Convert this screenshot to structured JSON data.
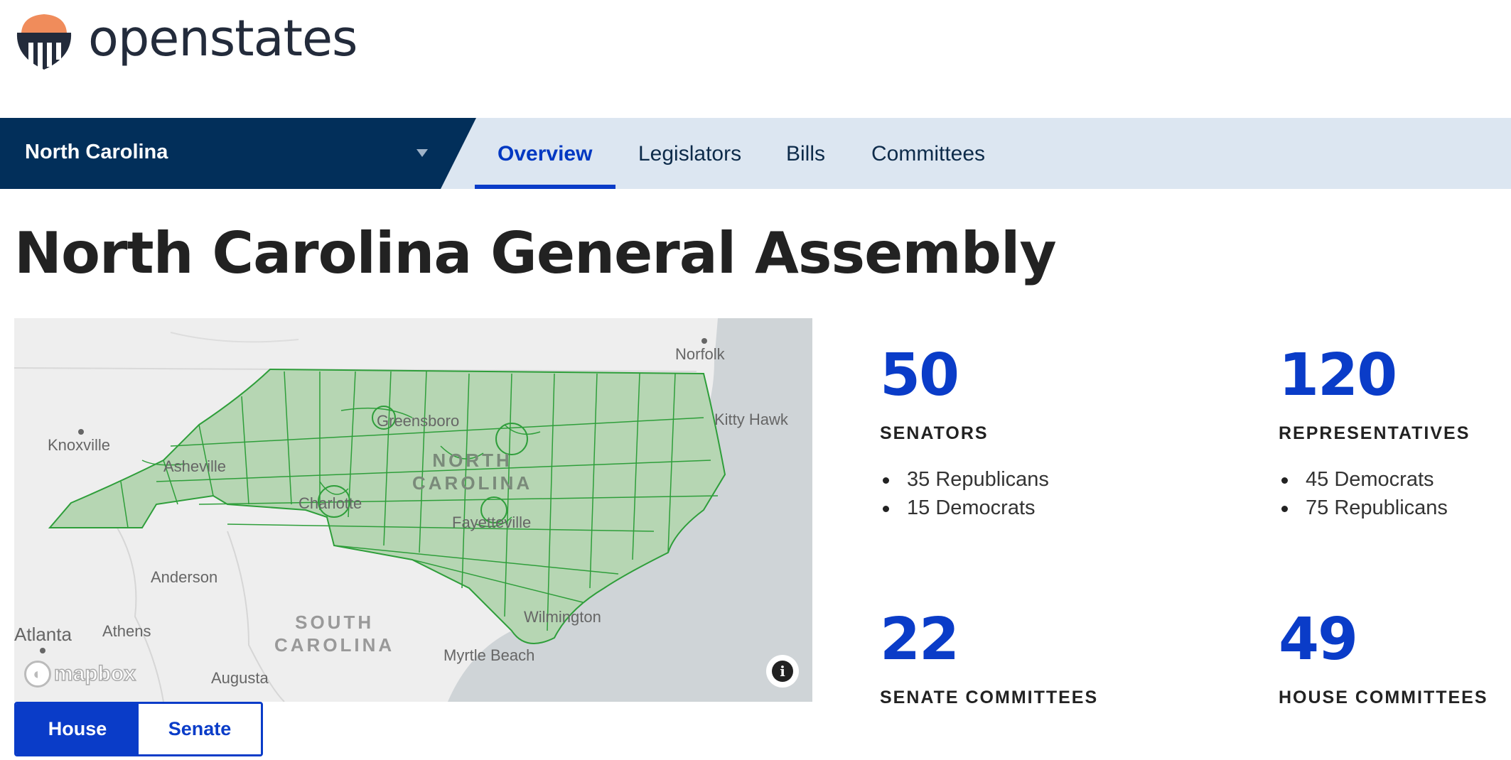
{
  "brand": {
    "name": "openstates",
    "colors": {
      "orange": "#f08c5b",
      "navy": "#232b3b"
    }
  },
  "nav": {
    "state": "North Carolina",
    "tabs": [
      {
        "label": "Overview",
        "active": true
      },
      {
        "label": "Legislators",
        "active": false
      },
      {
        "label": "Bills",
        "active": false
      },
      {
        "label": "Committees",
        "active": false
      }
    ]
  },
  "page": {
    "title": "North Carolina General Assembly"
  },
  "map": {
    "labels": {
      "norfolk": "Norfolk",
      "kitty_hawk": "Kitty Hawk",
      "knoxville": "Knoxville",
      "asheville": "Asheville",
      "greensboro": "Greensboro",
      "north_carolina": "NORTH\nCAROLINA",
      "charlotte": "Charlotte",
      "fayetteville": "Fayetteville",
      "anderson": "Anderson",
      "south_carolina": "SOUTH\nCAROLINA",
      "atlanta": "Atlanta",
      "athens": "Athens",
      "wilmington": "Wilmington",
      "myrtle_beach": "Myrtle Beach",
      "augusta": "Augusta"
    },
    "attribution": "mapbox",
    "info_icon": "i",
    "district_color": "#2e9e3a"
  },
  "chamber_toggle": {
    "house": "House",
    "senate": "Senate",
    "selected": "House"
  },
  "stats": {
    "senators": {
      "count": "50",
      "caption": "SENATORS",
      "breakdown": [
        "35 Republicans",
        "15 Democrats"
      ]
    },
    "representatives": {
      "count": "120",
      "caption": "REPRESENTATIVES",
      "breakdown": [
        "45 Democrats",
        "75 Republicans"
      ]
    },
    "senate_committees": {
      "count": "22",
      "caption": "SENATE COMMITTEES"
    },
    "house_committees": {
      "count": "49",
      "caption": "HOUSE COMMITTEES"
    }
  }
}
